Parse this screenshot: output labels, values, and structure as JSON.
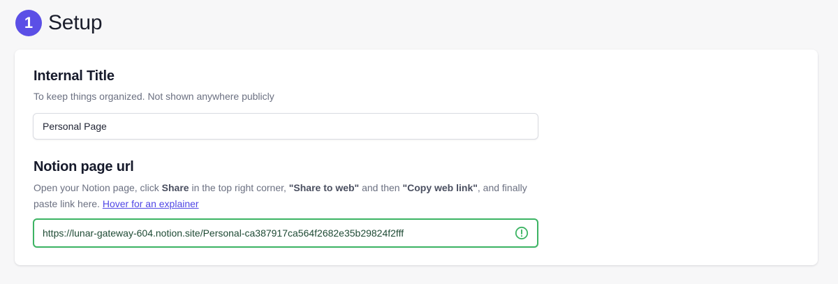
{
  "step": {
    "number": "1",
    "title": "Setup",
    "accent_color": "#5b4fe6"
  },
  "internal_title": {
    "label": "Internal Title",
    "help": "To keep things organized. Not shown anywhere publicly",
    "value": "Personal Page"
  },
  "notion_url": {
    "label": "Notion page url",
    "help_parts": [
      "Open your Notion page, click ",
      "Share",
      " in the top right corner, ",
      "\"Share to web\"",
      " and then ",
      "\"Copy web link\"",
      ", and finally paste link here. ",
      "Hover for an explainer"
    ],
    "value": "https://lunar-gateway-604.notion.site/Personal-ca387917ca564f2682e35b29824f2fff",
    "status_icon": "exclamation-circle-icon",
    "status_color": "#3cb463"
  }
}
